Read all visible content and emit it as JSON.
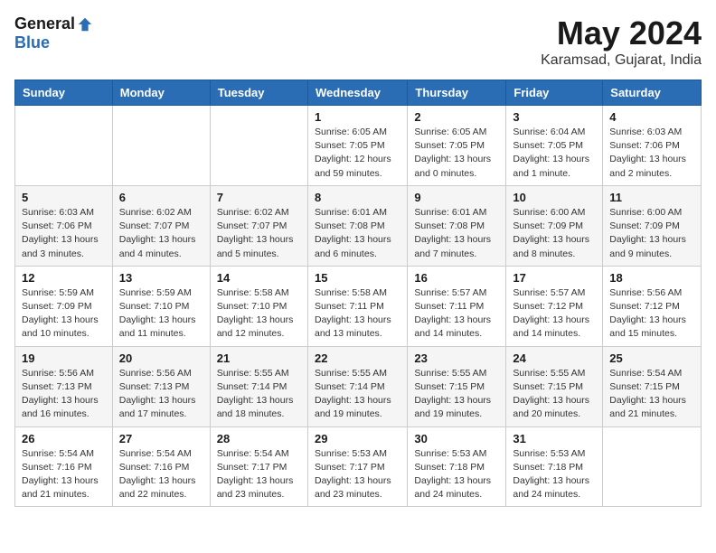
{
  "header": {
    "logo_general": "General",
    "logo_blue": "Blue",
    "month_title": "May 2024",
    "location": "Karamsad, Gujarat, India"
  },
  "weekdays": [
    "Sunday",
    "Monday",
    "Tuesday",
    "Wednesday",
    "Thursday",
    "Friday",
    "Saturday"
  ],
  "weeks": [
    [
      {
        "day": "",
        "info": ""
      },
      {
        "day": "",
        "info": ""
      },
      {
        "day": "",
        "info": ""
      },
      {
        "day": "1",
        "info": "Sunrise: 6:05 AM\nSunset: 7:05 PM\nDaylight: 12 hours\nand 59 minutes."
      },
      {
        "day": "2",
        "info": "Sunrise: 6:05 AM\nSunset: 7:05 PM\nDaylight: 13 hours\nand 0 minutes."
      },
      {
        "day": "3",
        "info": "Sunrise: 6:04 AM\nSunset: 7:05 PM\nDaylight: 13 hours\nand 1 minute."
      },
      {
        "day": "4",
        "info": "Sunrise: 6:03 AM\nSunset: 7:06 PM\nDaylight: 13 hours\nand 2 minutes."
      }
    ],
    [
      {
        "day": "5",
        "info": "Sunrise: 6:03 AM\nSunset: 7:06 PM\nDaylight: 13 hours\nand 3 minutes."
      },
      {
        "day": "6",
        "info": "Sunrise: 6:02 AM\nSunset: 7:07 PM\nDaylight: 13 hours\nand 4 minutes."
      },
      {
        "day": "7",
        "info": "Sunrise: 6:02 AM\nSunset: 7:07 PM\nDaylight: 13 hours\nand 5 minutes."
      },
      {
        "day": "8",
        "info": "Sunrise: 6:01 AM\nSunset: 7:08 PM\nDaylight: 13 hours\nand 6 minutes."
      },
      {
        "day": "9",
        "info": "Sunrise: 6:01 AM\nSunset: 7:08 PM\nDaylight: 13 hours\nand 7 minutes."
      },
      {
        "day": "10",
        "info": "Sunrise: 6:00 AM\nSunset: 7:09 PM\nDaylight: 13 hours\nand 8 minutes."
      },
      {
        "day": "11",
        "info": "Sunrise: 6:00 AM\nSunset: 7:09 PM\nDaylight: 13 hours\nand 9 minutes."
      }
    ],
    [
      {
        "day": "12",
        "info": "Sunrise: 5:59 AM\nSunset: 7:09 PM\nDaylight: 13 hours\nand 10 minutes."
      },
      {
        "day": "13",
        "info": "Sunrise: 5:59 AM\nSunset: 7:10 PM\nDaylight: 13 hours\nand 11 minutes."
      },
      {
        "day": "14",
        "info": "Sunrise: 5:58 AM\nSunset: 7:10 PM\nDaylight: 13 hours\nand 12 minutes."
      },
      {
        "day": "15",
        "info": "Sunrise: 5:58 AM\nSunset: 7:11 PM\nDaylight: 13 hours\nand 13 minutes."
      },
      {
        "day": "16",
        "info": "Sunrise: 5:57 AM\nSunset: 7:11 PM\nDaylight: 13 hours\nand 14 minutes."
      },
      {
        "day": "17",
        "info": "Sunrise: 5:57 AM\nSunset: 7:12 PM\nDaylight: 13 hours\nand 14 minutes."
      },
      {
        "day": "18",
        "info": "Sunrise: 5:56 AM\nSunset: 7:12 PM\nDaylight: 13 hours\nand 15 minutes."
      }
    ],
    [
      {
        "day": "19",
        "info": "Sunrise: 5:56 AM\nSunset: 7:13 PM\nDaylight: 13 hours\nand 16 minutes."
      },
      {
        "day": "20",
        "info": "Sunrise: 5:56 AM\nSunset: 7:13 PM\nDaylight: 13 hours\nand 17 minutes."
      },
      {
        "day": "21",
        "info": "Sunrise: 5:55 AM\nSunset: 7:14 PM\nDaylight: 13 hours\nand 18 minutes."
      },
      {
        "day": "22",
        "info": "Sunrise: 5:55 AM\nSunset: 7:14 PM\nDaylight: 13 hours\nand 19 minutes."
      },
      {
        "day": "23",
        "info": "Sunrise: 5:55 AM\nSunset: 7:15 PM\nDaylight: 13 hours\nand 19 minutes."
      },
      {
        "day": "24",
        "info": "Sunrise: 5:55 AM\nSunset: 7:15 PM\nDaylight: 13 hours\nand 20 minutes."
      },
      {
        "day": "25",
        "info": "Sunrise: 5:54 AM\nSunset: 7:15 PM\nDaylight: 13 hours\nand 21 minutes."
      }
    ],
    [
      {
        "day": "26",
        "info": "Sunrise: 5:54 AM\nSunset: 7:16 PM\nDaylight: 13 hours\nand 21 minutes."
      },
      {
        "day": "27",
        "info": "Sunrise: 5:54 AM\nSunset: 7:16 PM\nDaylight: 13 hours\nand 22 minutes."
      },
      {
        "day": "28",
        "info": "Sunrise: 5:54 AM\nSunset: 7:17 PM\nDaylight: 13 hours\nand 23 minutes."
      },
      {
        "day": "29",
        "info": "Sunrise: 5:53 AM\nSunset: 7:17 PM\nDaylight: 13 hours\nand 23 minutes."
      },
      {
        "day": "30",
        "info": "Sunrise: 5:53 AM\nSunset: 7:18 PM\nDaylight: 13 hours\nand 24 minutes."
      },
      {
        "day": "31",
        "info": "Sunrise: 5:53 AM\nSunset: 7:18 PM\nDaylight: 13 hours\nand 24 minutes."
      },
      {
        "day": "",
        "info": ""
      }
    ]
  ]
}
